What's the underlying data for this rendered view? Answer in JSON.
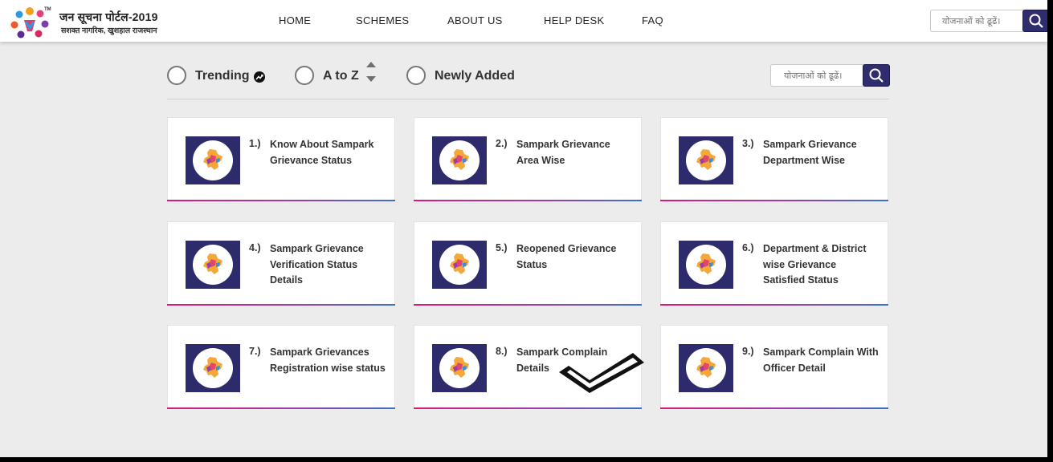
{
  "header": {
    "brand_title": "जन सूचना पोर्टल-2019",
    "brand_tm": "TM",
    "brand_tagline": "सशक्त नागरिक, खुशहाल राजस्थान",
    "logo_icon": "portal-logo-icon",
    "nav": [
      "HOME",
      "SCHEMES",
      "ABOUT US",
      "HELP DESK",
      "FAQ"
    ],
    "search_placeholder": "योजनाओं को ढूढें।",
    "search_icon": "search-icon"
  },
  "filters": {
    "options": [
      {
        "label": "Trending",
        "badge_icon": "trending-icon",
        "selected": false
      },
      {
        "label": "A to Z",
        "badge_icon": "sort-updown-icon",
        "selected": false
      },
      {
        "label": "Newly Added",
        "selected": false
      }
    ],
    "search_placeholder": "योजनाओं को ढूढें।",
    "search_icon": "search-icon"
  },
  "cards": [
    {
      "number": "1.)",
      "title": "Know About Sampark Grievance Status"
    },
    {
      "number": "2.)",
      "title": "Sampark Grievance Area Wise"
    },
    {
      "number": "3.)",
      "title": "Sampark Grievance Department Wise"
    },
    {
      "number": "4.)",
      "title": "Sampark Grievance Verification Status Details"
    },
    {
      "number": "5.)",
      "title": "Reopened Grievance Status"
    },
    {
      "number": "6.)",
      "title": "Department & District wise Grievance Satisfied Status"
    },
    {
      "number": "7.)",
      "title": "Sampark Grievances Registration wise status"
    },
    {
      "number": "8.)",
      "title": "Sampark Complain Details"
    },
    {
      "number": "9.)",
      "title": "Sampark Complain With Officer Detail"
    }
  ],
  "card_icon": "rajasthan-map-icon",
  "annotation_icon": "checkmark-annotation-icon",
  "colors": {
    "accent_navy": "#2f2d6e",
    "card_bar_start": "#d81b77",
    "card_bar_end": "#3b6fc9",
    "background": "#ececec"
  }
}
